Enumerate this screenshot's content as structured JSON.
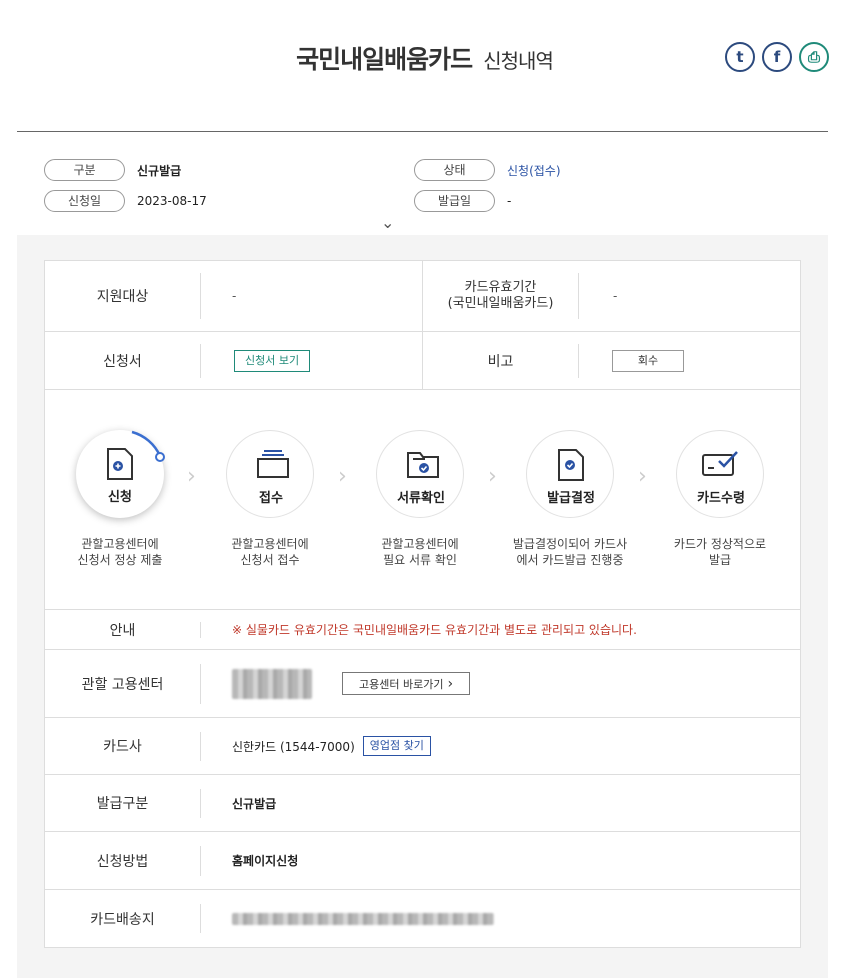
{
  "header": {
    "title_main": "국민내일배움카드",
    "title_sub": "신청내역",
    "share": [
      {
        "icon": "twitter-icon",
        "glyph": "t"
      },
      {
        "icon": "facebook-icon",
        "glyph": "f"
      },
      {
        "icon": "printer-icon",
        "glyph": "⎙"
      }
    ]
  },
  "summary": {
    "type_label": "구분",
    "type_value": "신규발급",
    "status_label": "상태",
    "status_value": "신청(접수)",
    "apply_date_label": "신청일",
    "apply_date_value": "2023-08-17",
    "issue_date_label": "발급일",
    "issue_date_value": "-",
    "expand_glyph": "⌄"
  },
  "info_table": {
    "target_label": "지원대상",
    "target_value": "-",
    "validity_label_1": "카드유효기간",
    "validity_label_2": "(국민내일배움카드)",
    "validity_value": "-",
    "form_label": "신청서",
    "form_button": "신청서 보기",
    "note_label": "비고",
    "note_button": "회수"
  },
  "steps": [
    {
      "label": "신청",
      "desc_1": "관할고용센터에",
      "desc_2": "신청서 정상 제출",
      "icon": "document-add-icon",
      "active": true
    },
    {
      "label": "접수",
      "desc_1": "관할고용센터에",
      "desc_2": "신청서 접수",
      "icon": "tray-icon",
      "active": false
    },
    {
      "label": "서류확인",
      "desc_1": "관할고용센터에",
      "desc_2": "필요 서류 확인",
      "icon": "folder-check-icon",
      "active": false
    },
    {
      "label": "발급결정",
      "desc_1": "발급결정이되어 카드사",
      "desc_2": "에서 카드발급 진행중",
      "icon": "document-check-icon",
      "active": false
    },
    {
      "label": "카드수령",
      "desc_1": "카드가 정상적으로",
      "desc_2": "발급",
      "icon": "card-check-icon",
      "active": false
    }
  ],
  "detail": {
    "notice_label": "안내",
    "notice_text": "※ 실물카드 유효기간은 국민내일배움카드 유효기간과 별도로 관리되고 있습니다.",
    "center_label": "관할 고용센터",
    "center_button": "고용센터 바로가기",
    "center_button_glyph": "›",
    "card_company_label": "카드사",
    "card_company_value": "신한카드 (1544-7000)",
    "branch_button": "영업점 찾기",
    "issue_type_label": "발급구분",
    "issue_type_value": "신규발급",
    "method_label": "신청방법",
    "method_value": "홈페이지신청",
    "delivery_label": "카드배송지"
  },
  "colors": {
    "accent_teal": "#1f8a79",
    "accent_blue": "#2a52a4",
    "notice_red": "#c0392b",
    "progress_blue": "#3b6fd0"
  }
}
